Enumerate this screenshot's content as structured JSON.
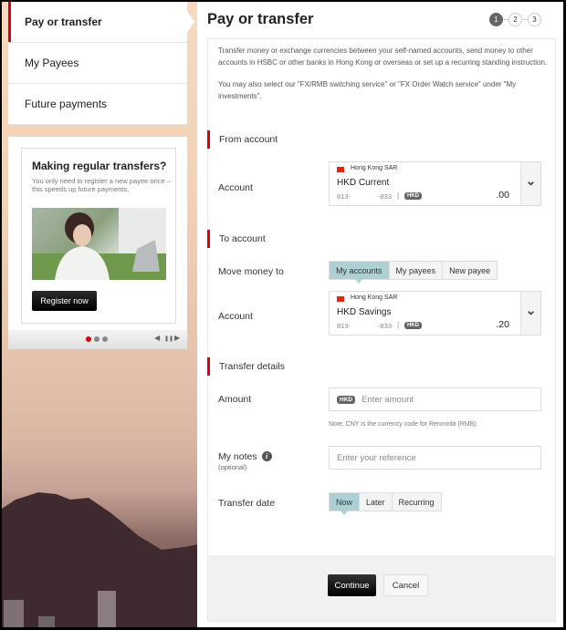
{
  "sidebar": {
    "items": [
      {
        "label": "Pay or transfer",
        "active": true
      },
      {
        "label": "My Payees",
        "active": false
      },
      {
        "label": "Future payments",
        "active": false
      }
    ]
  },
  "promo": {
    "title": "Making regular transfers?",
    "text": "You only need to register a new payee once – this speeds up future payments.",
    "button_label": "Register now",
    "carousel": {
      "slides": 3,
      "current": 1,
      "controls": [
        "◀",
        "❚❚",
        "▶"
      ]
    }
  },
  "colors": {
    "accent": "#db0011",
    "selected_segment": "#acd0d4",
    "primary_button": "#000000"
  },
  "main": {
    "title": "Pay or transfer",
    "steps": [
      "1",
      "2",
      "3"
    ],
    "current_step": 1,
    "intro": [
      "Transfer money or exchange currencies between your self-named accounts, send money to other accounts in HSBC or other banks in Hong Kong or overseas or set up a recurring standing instruction.",
      "You may also select our \"FX/RMB switching service\" or \"FX Order Watch service\" under \"My investments\"."
    ],
    "from_section": {
      "heading": "From account",
      "account_label": "Account",
      "account": {
        "region": "Hong Kong SAR",
        "name": "HKD Current",
        "number_prefix": "813-",
        "number_suffix": "-833",
        "separator": "|",
        "currency": "HKD",
        "balance": ".00"
      }
    },
    "to_section": {
      "heading": "To account",
      "move_label": "Move money to",
      "move_options": [
        "My accounts",
        "My payees",
        "New payee"
      ],
      "move_selected": "My accounts",
      "account_label": "Account",
      "account": {
        "region": "Hong Kong SAR",
        "name": "HKD Savings",
        "number_prefix": "813-",
        "number_suffix": "-833",
        "separator": "|",
        "currency": "HKD",
        "balance": ".20"
      }
    },
    "details_section": {
      "heading": "Transfer details",
      "amount_label": "Amount",
      "amount_currency": "HKD",
      "amount_placeholder": "Enter amount",
      "amount_value": "",
      "note": "Note: CNY is the currency code for Renminbi (RMB)",
      "notes_label": "My notes",
      "notes_sublabel": "(optional)",
      "notes_info_icon": "i",
      "notes_placeholder": "Enter your reference",
      "notes_value": "",
      "date_label": "Transfer date",
      "date_options": [
        "Now",
        "Later",
        "Recurring"
      ],
      "date_selected": "Now"
    },
    "actions": {
      "continue_label": "Continue",
      "cancel_label": "Cancel"
    }
  }
}
